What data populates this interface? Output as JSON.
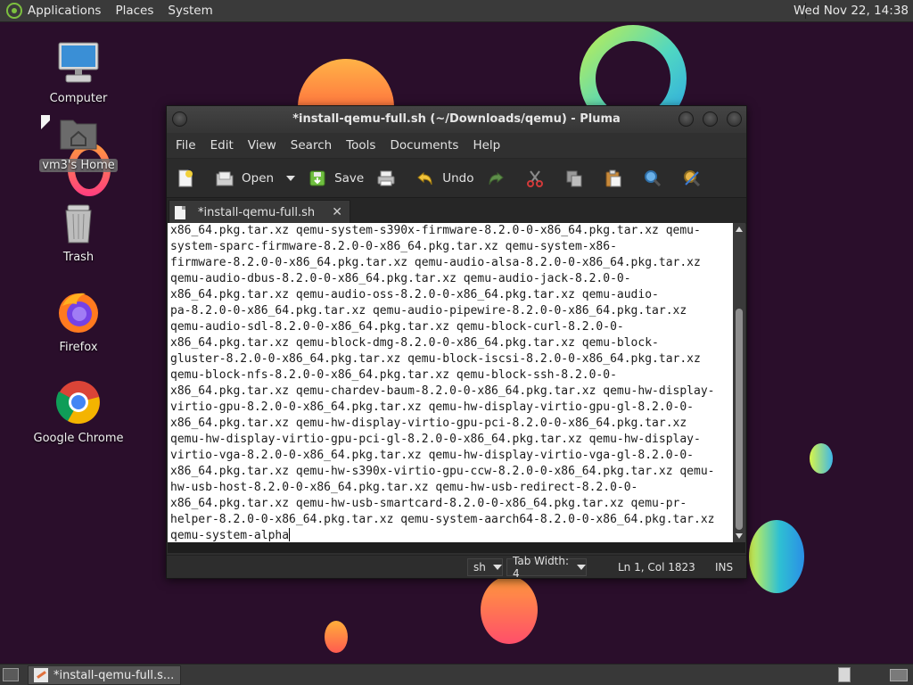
{
  "top_panel": {
    "menus": [
      "Applications",
      "Places",
      "System"
    ],
    "clock": "Wed Nov 22, 14:38"
  },
  "desktop": {
    "icons": [
      {
        "label": "Computer",
        "icon": "computer-icon"
      },
      {
        "label": "vm3's Home",
        "icon": "home-folder-icon"
      },
      {
        "label": "Trash",
        "icon": "trash-icon"
      },
      {
        "label": "Firefox",
        "icon": "firefox-icon"
      },
      {
        "label": "Google Chrome",
        "icon": "chrome-icon"
      }
    ]
  },
  "window": {
    "title": "*install-qemu-full.sh (~/Downloads/qemu) - Pluma",
    "menu": [
      "File",
      "Edit",
      "View",
      "Search",
      "Tools",
      "Documents",
      "Help"
    ],
    "toolbar": {
      "open_label": "Open",
      "save_label": "Save",
      "undo_label": "Undo"
    },
    "tab": {
      "label": "*install-qemu-full.sh",
      "close": "✕"
    },
    "editor_lines": [
      "x86_64.pkg.tar.xz qemu-system-s390x-firmware-8.2.0-0-x86_64.pkg.tar.xz qemu-",
      "system-sparc-firmware-8.2.0-0-x86_64.pkg.tar.xz qemu-system-x86-",
      "firmware-8.2.0-0-x86_64.pkg.tar.xz qemu-audio-alsa-8.2.0-0-x86_64.pkg.tar.xz",
      "qemu-audio-dbus-8.2.0-0-x86_64.pkg.tar.xz qemu-audio-jack-8.2.0-0-",
      "x86_64.pkg.tar.xz qemu-audio-oss-8.2.0-0-x86_64.pkg.tar.xz qemu-audio-",
      "pa-8.2.0-0-x86_64.pkg.tar.xz qemu-audio-pipewire-8.2.0-0-x86_64.pkg.tar.xz",
      "qemu-audio-sdl-8.2.0-0-x86_64.pkg.tar.xz qemu-block-curl-8.2.0-0-",
      "x86_64.pkg.tar.xz qemu-block-dmg-8.2.0-0-x86_64.pkg.tar.xz qemu-block-",
      "gluster-8.2.0-0-x86_64.pkg.tar.xz qemu-block-iscsi-8.2.0-0-x86_64.pkg.tar.xz",
      "qemu-block-nfs-8.2.0-0-x86_64.pkg.tar.xz qemu-block-ssh-8.2.0-0-",
      "x86_64.pkg.tar.xz qemu-chardev-baum-8.2.0-0-x86_64.pkg.tar.xz qemu-hw-display-",
      "virtio-gpu-8.2.0-0-x86_64.pkg.tar.xz qemu-hw-display-virtio-gpu-gl-8.2.0-0-",
      "x86_64.pkg.tar.xz qemu-hw-display-virtio-gpu-pci-8.2.0-0-x86_64.pkg.tar.xz",
      "qemu-hw-display-virtio-gpu-pci-gl-8.2.0-0-x86_64.pkg.tar.xz qemu-hw-display-",
      "virtio-vga-8.2.0-0-x86_64.pkg.tar.xz qemu-hw-display-virtio-vga-gl-8.2.0-0-",
      "x86_64.pkg.tar.xz qemu-hw-s390x-virtio-gpu-ccw-8.2.0-0-x86_64.pkg.tar.xz qemu-",
      "hw-usb-host-8.2.0-0-x86_64.pkg.tar.xz qemu-hw-usb-redirect-8.2.0-0-",
      "x86_64.pkg.tar.xz qemu-hw-usb-smartcard-8.2.0-0-x86_64.pkg.tar.xz qemu-pr-",
      "helper-8.2.0-0-x86_64.pkg.tar.xz qemu-system-aarch64-8.2.0-0-x86_64.pkg.tar.xz",
      "qemu-system-alpha"
    ],
    "statusbar": {
      "language": "sh",
      "tab_width": "Tab Width:  4",
      "position": "Ln 1, Col 1823",
      "mode": "INS"
    }
  },
  "bottom_panel": {
    "task_label": "*install-qemu-full.s..."
  },
  "colors": {
    "wallpaper": "#2a0e2b",
    "panel": "#3a3a3a",
    "editor_bg": "#ffffff"
  }
}
